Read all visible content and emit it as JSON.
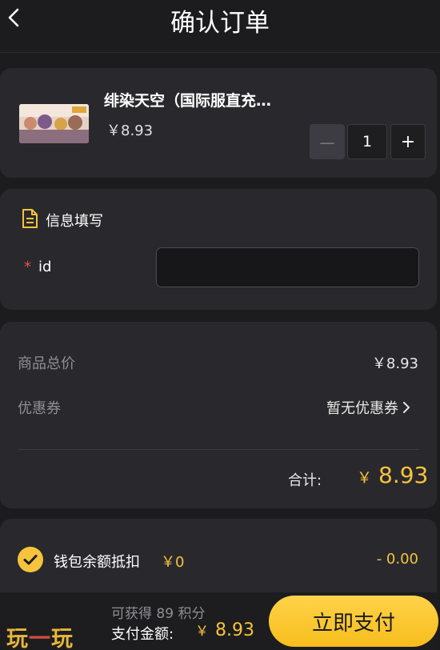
{
  "header": {
    "title": "确认订单"
  },
  "product": {
    "title": "绯染天空（国际服直充…",
    "price": "￥8.93",
    "quantity": "1",
    "minus_label": "－",
    "plus_label": "+"
  },
  "info": {
    "section_title": "信息填写",
    "required_mark": "*",
    "field_label": "id",
    "field_value": ""
  },
  "pricing": {
    "subtotal_label": "商品总价",
    "subtotal_value": "￥8.93",
    "coupon_label": "优惠券",
    "coupon_value": "暂无优惠券",
    "total_label": "合计:",
    "total_currency": "￥",
    "total_value": "8.93"
  },
  "wallet": {
    "label": "钱包余额抵扣",
    "balance": "￥0",
    "deduction": "- 0.00",
    "checked": true
  },
  "footer": {
    "points_text": "可获得 89 积分",
    "pay_label": "支付金额:",
    "pay_currency": "￥",
    "pay_value": "8.93",
    "pay_button": "立即支付"
  },
  "watermark": {
    "part1": "玩",
    "part2": "一",
    "part3": "玩"
  },
  "colors": {
    "accent": "#f6c33c",
    "background": "#1c1c1f",
    "card": "#29292d",
    "required": "#e8524a"
  },
  "icons": {
    "back": "chevron-left-icon",
    "doc": "document-icon",
    "coupon_arrow": "chevron-right-icon",
    "check": "check-circle-icon"
  }
}
